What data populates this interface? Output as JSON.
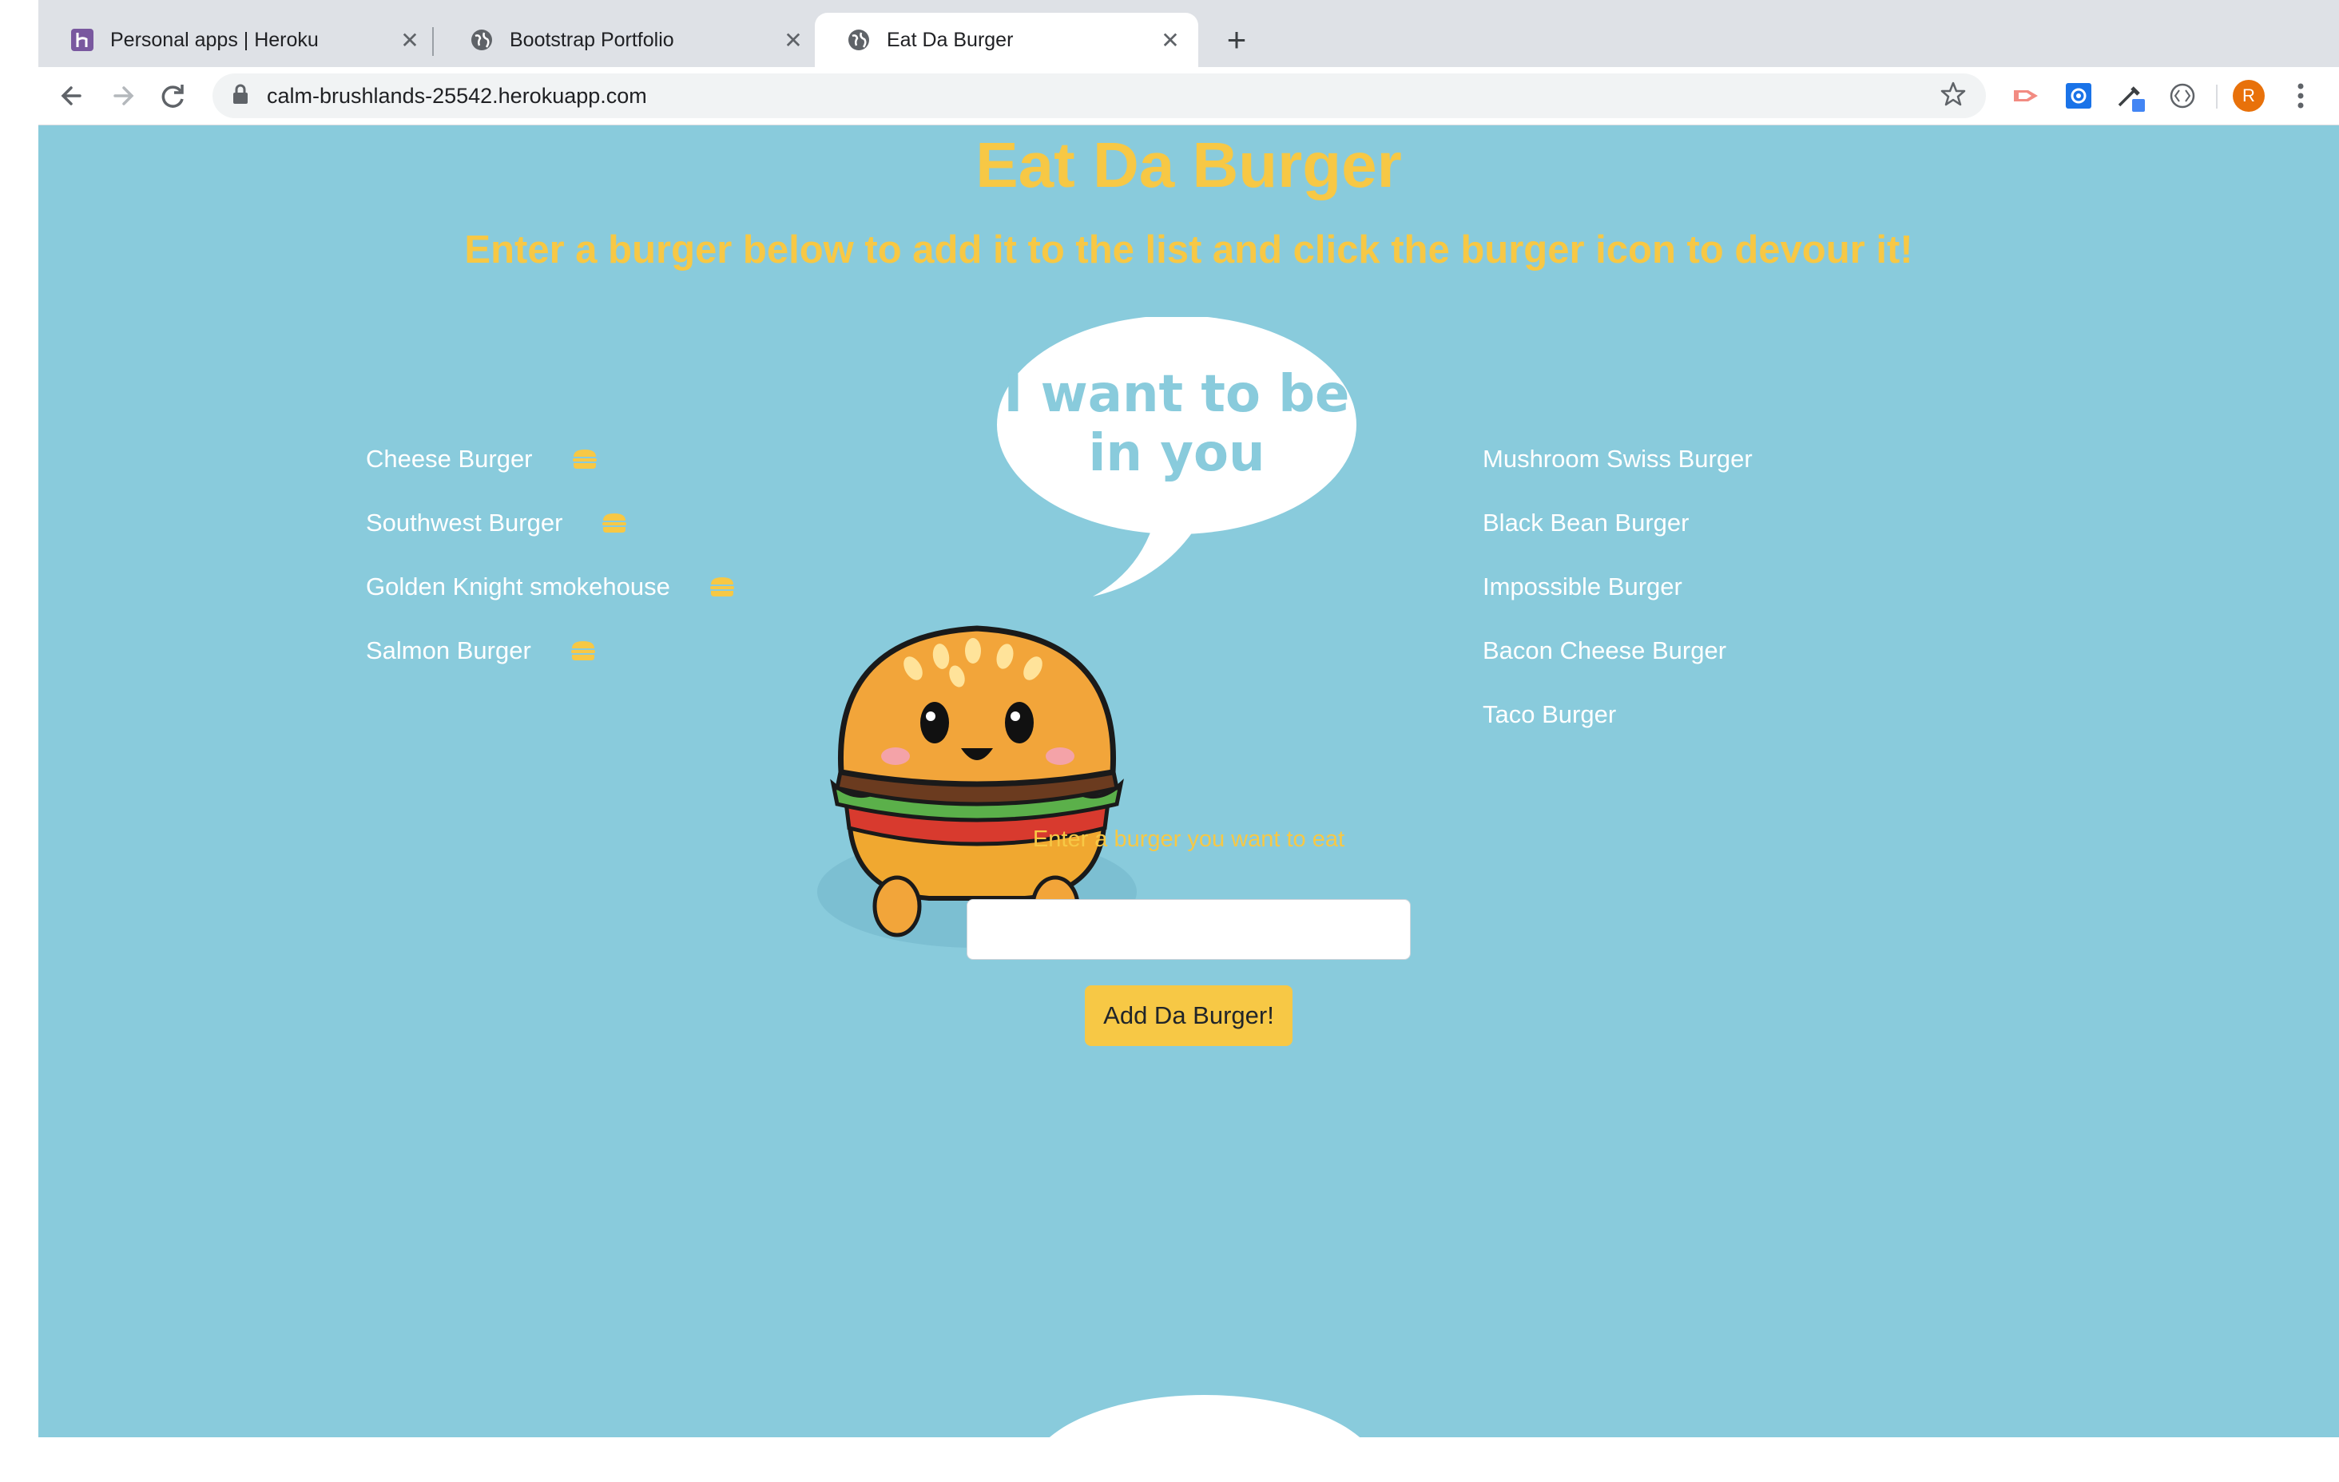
{
  "browser": {
    "tabs": [
      {
        "title": "Personal apps | Heroku",
        "favicon": "heroku-icon",
        "active": false
      },
      {
        "title": "Bootstrap Portfolio",
        "favicon": "globe-icon",
        "active": false
      },
      {
        "title": "Eat Da Burger",
        "favicon": "globe-icon",
        "active": true
      }
    ],
    "new_tab_label": "+",
    "url": "calm-brushlands-25542.herokuapp.com",
    "profile_initial": "R"
  },
  "page": {
    "title": "Eat Da Burger",
    "subtitle": "Enter a burger below to add it to the list and click the burger icon to devour it!",
    "speech_bubble": "I want to be in you",
    "speech_lines": [
      "I want to be",
      "in you"
    ],
    "uneaten_burgers": [
      "Cheese Burger",
      "Southwest Burger",
      "Golden Knight smokehouse",
      "Salmon Burger"
    ],
    "devoured_burgers": [
      "Mushroom Swiss Burger",
      "Black Bean Burger",
      "Impossible Burger",
      "Bacon Cheese Burger",
      "Taco Burger"
    ],
    "form": {
      "label": "Enter a burger you want to eat",
      "input_value": "",
      "submit_label": "Add Da Burger!"
    }
  },
  "colors": {
    "page_background": "#89cbdc",
    "accent": "#f7c845",
    "list_text": "#ffffff"
  }
}
